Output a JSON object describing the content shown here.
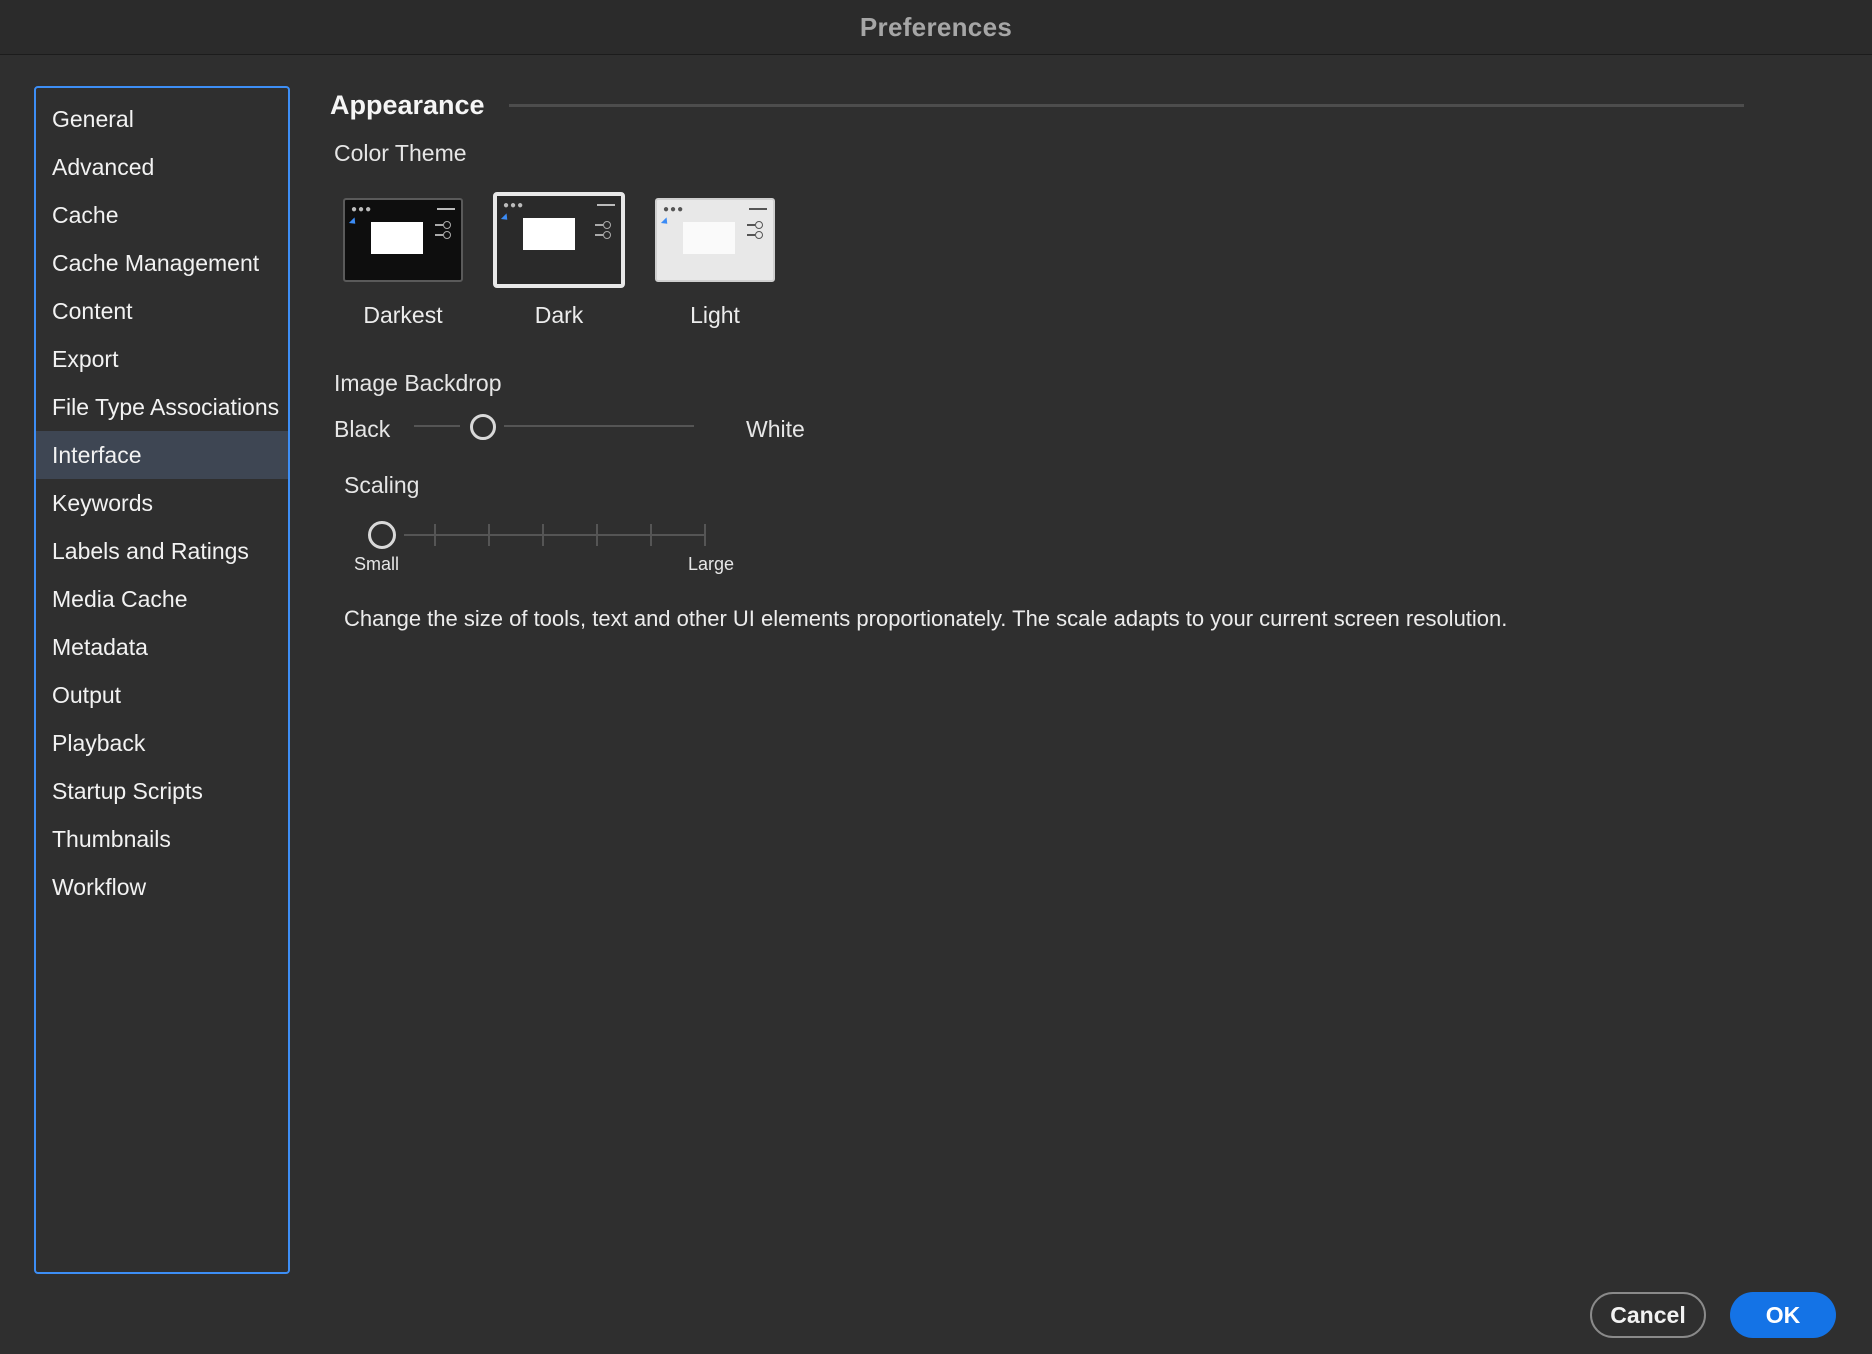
{
  "window": {
    "title": "Preferences"
  },
  "sidebar": {
    "items": [
      {
        "label": "General"
      },
      {
        "label": "Advanced"
      },
      {
        "label": "Cache"
      },
      {
        "label": "Cache Management"
      },
      {
        "label": "Content"
      },
      {
        "label": "Export"
      },
      {
        "label": "File Type Associations"
      },
      {
        "label": "Interface",
        "selected": true
      },
      {
        "label": "Keywords"
      },
      {
        "label": "Labels and Ratings"
      },
      {
        "label": "Media Cache"
      },
      {
        "label": "Metadata"
      },
      {
        "label": "Output"
      },
      {
        "label": "Playback"
      },
      {
        "label": "Startup Scripts"
      },
      {
        "label": "Thumbnails"
      },
      {
        "label": "Workflow"
      }
    ]
  },
  "appearance": {
    "heading": "Appearance",
    "color_theme_label": "Color Theme",
    "themes": [
      {
        "label": "Darkest",
        "selected": false
      },
      {
        "label": "Dark",
        "selected": true
      },
      {
        "label": "Light",
        "selected": false
      }
    ],
    "image_backdrop": {
      "label": "Image Backdrop",
      "min_label": "Black",
      "max_label": "White",
      "value_fraction": 0.22
    },
    "scaling": {
      "label": "Scaling",
      "min_label": "Small",
      "max_label": "Large",
      "value_fraction": 0.0
    },
    "description": "Change the size of tools, text and other UI elements proportionately. The scale adapts to your current screen resolution."
  },
  "buttons": {
    "cancel": "Cancel",
    "ok": "OK"
  },
  "colors": {
    "accent": "#1473e6",
    "sidebar_border": "#3d8ef5",
    "selected_item": "#3e4653",
    "background": "#2f2f2f"
  }
}
